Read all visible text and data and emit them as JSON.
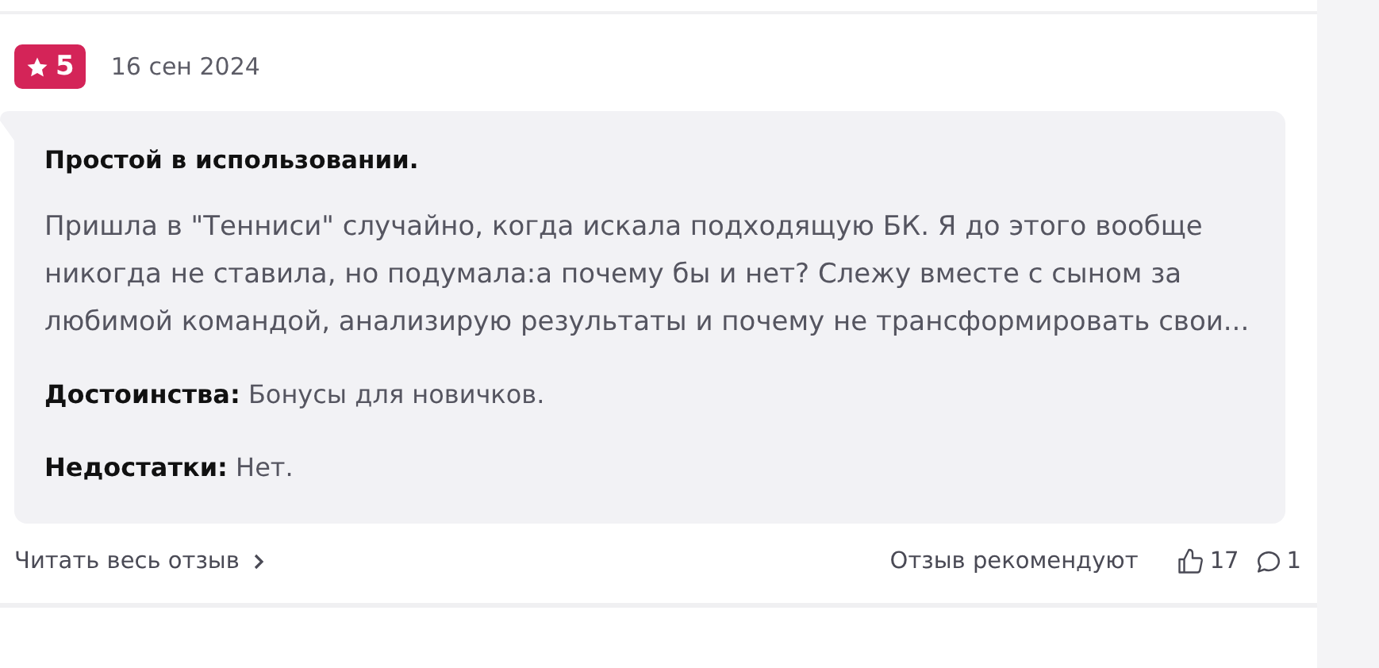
{
  "review": {
    "rating": "5",
    "date": "16 сен 2024",
    "title": "Простой в использовании.",
    "text": "Пришла в \"Тенниси\" случайно, когда искала подходящую БК. Я до этого вообще никогда не ставила, но подумала:а почему бы и нет? Слежу вместе с сыном за любимой командой, анализирую результаты и почему не трансформировать свои...",
    "pros": {
      "label": "Достоинства:",
      "value": "Бонусы для новичков."
    },
    "cons": {
      "label": "Недостатки:",
      "value": "Нет."
    },
    "read_more": "Читать весь отзыв",
    "recommend_label": "Отзыв рекомендуют",
    "likes": "17",
    "comments": "1"
  }
}
